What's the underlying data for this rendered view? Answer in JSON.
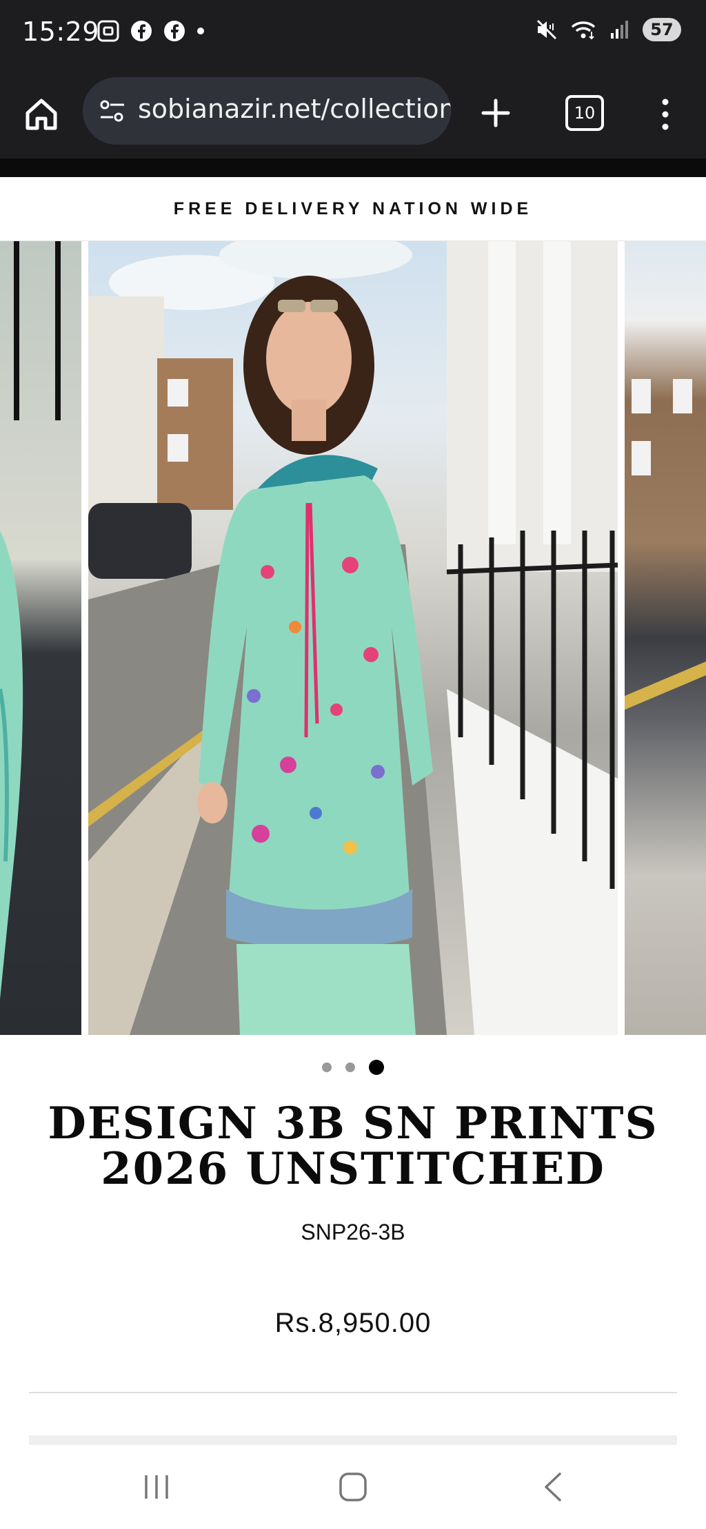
{
  "status_bar": {
    "time": "15:29",
    "battery": "57",
    "icons": [
      "screenshot-icon",
      "facebook-icon",
      "facebook-icon",
      "dot-icon",
      "mute-icon",
      "wifi-icon",
      "signal-icon",
      "battery-icon"
    ]
  },
  "browser": {
    "url": "sobianazir.net/collection",
    "tab_count": "10"
  },
  "announcement": "FREE DELIVERY NATION WIDE",
  "gallery": {
    "slide_count": 3,
    "active_slide": 3
  },
  "product": {
    "title_line1": "DESIGN 3B SN PRINTS",
    "title_line2": "2026 UNSTITCHED",
    "sku": "SNP26-3B",
    "price": "Rs.8,950.00"
  },
  "colors": {
    "accent": "#000000",
    "topbar": "#1d1d1f",
    "garment": "#8fd8c0"
  }
}
